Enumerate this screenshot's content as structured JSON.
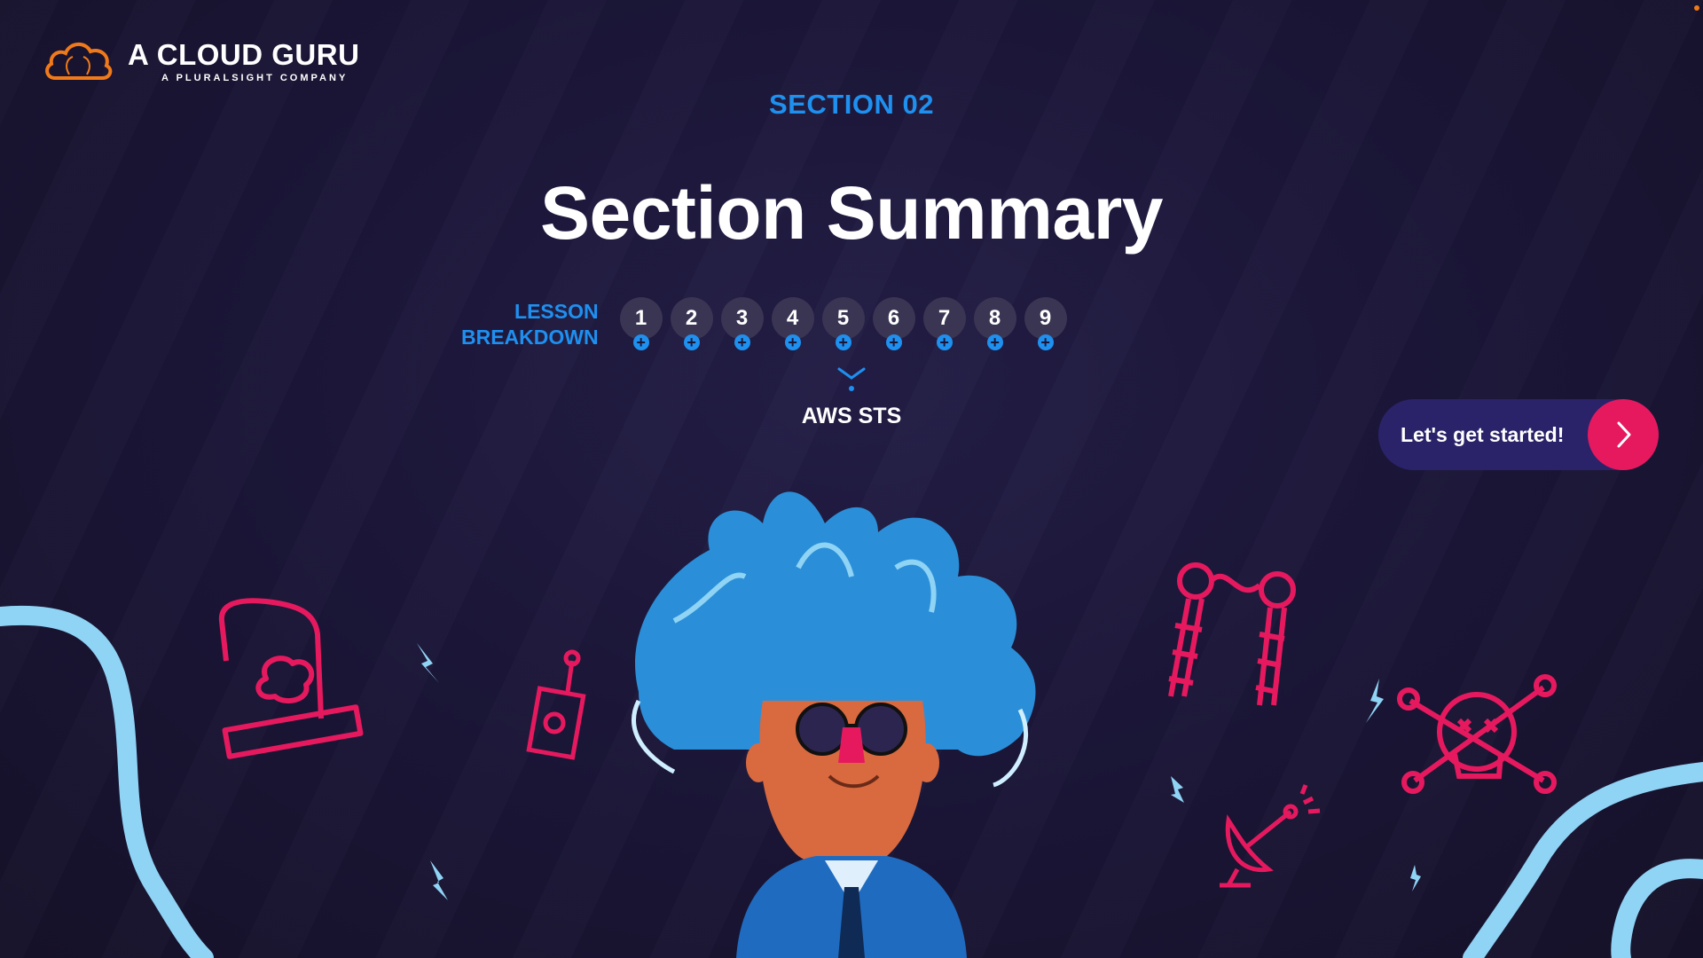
{
  "brand": {
    "name": "A CLOUD GURU",
    "tagline": "A PLURALSIGHT COMPANY",
    "accent_color": "#f07a1a"
  },
  "section": {
    "label": "SECTION 02",
    "title": "Section Summary"
  },
  "lessons": {
    "label_line1": "LESSON",
    "label_line2": "BREAKDOWN",
    "items": [
      "1",
      "2",
      "3",
      "4",
      "5",
      "6",
      "7",
      "8",
      "9"
    ],
    "selected_topic": "AWS STS"
  },
  "cta": {
    "label": "Let's get started!",
    "icon": "chevron-right-icon"
  },
  "colors": {
    "background": "#1b1636",
    "primary_blue": "#1e90f0",
    "cta_bg": "#2a236a",
    "cta_accent": "#e6195f",
    "illustration_pink": "#e6195f",
    "illustration_light_blue": "#8fd3f5"
  }
}
